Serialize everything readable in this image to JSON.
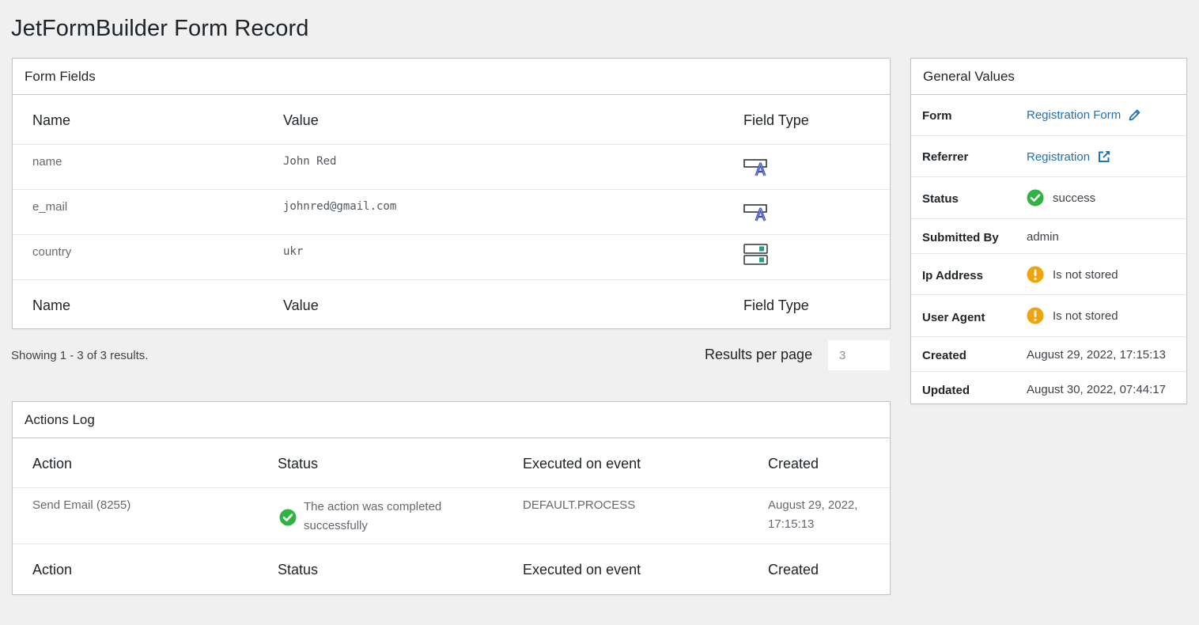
{
  "page": {
    "title": "JetFormBuilder Form Record"
  },
  "form_fields": {
    "title": "Form Fields",
    "columns": {
      "name": "Name",
      "value": "Value",
      "type": "Field Type"
    },
    "rows": [
      {
        "name": "name",
        "value": "John Red",
        "type_icon": "text-field-icon"
      },
      {
        "name": "e_mail",
        "value": "johnred@gmail.com",
        "type_icon": "text-field-icon"
      },
      {
        "name": "country",
        "value": "ukr",
        "type_icon": "select-field-icon"
      }
    ],
    "showing": "Showing 1 - 3 of 3 results.",
    "results_per_page_label": "Results per page",
    "results_per_page_value": "3"
  },
  "actions_log": {
    "title": "Actions Log",
    "columns": {
      "action": "Action",
      "status": "Status",
      "event": "Executed on event",
      "created": "Created"
    },
    "rows": [
      {
        "action": "Send Email (8255)",
        "status_line1": "The action was completed",
        "status_line2": "successfully",
        "event": "DEFAULT.PROCESS",
        "created_line1": "August 29, 2022,",
        "created_line2": "17:15:13"
      }
    ]
  },
  "general_values": {
    "title": "General Values",
    "rows": {
      "form": {
        "label": "Form",
        "value": "Registration Form"
      },
      "referrer": {
        "label": "Referrer",
        "value": "Registration"
      },
      "status": {
        "label": "Status",
        "value": "success"
      },
      "submitted_by": {
        "label": "Submitted By",
        "value": "admin"
      },
      "ip_address": {
        "label": "Ip Address",
        "value": "Is not stored"
      },
      "user_agent": {
        "label": "User Agent",
        "value": "Is not stored"
      },
      "created": {
        "label": "Created",
        "value": "August 29, 2022, 17:15:13"
      },
      "updated": {
        "label": "Updated",
        "value": "August 30, 2022, 07:44:17"
      }
    }
  },
  "colors": {
    "link": "#2271b1",
    "success": "#2fb344",
    "warning": "#f0a30a",
    "icon_blue": "#3a4ab8",
    "icon_teal": "#1fa18a"
  }
}
